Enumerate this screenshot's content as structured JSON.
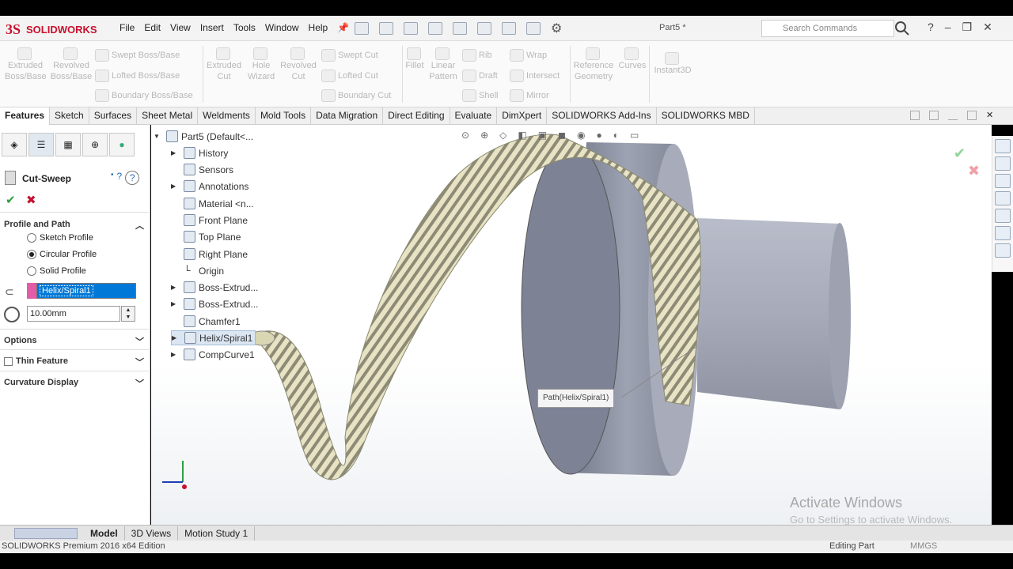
{
  "app": {
    "logo_text": "SOLIDWORKS",
    "doc_title": "Part5 *"
  },
  "menu": [
    "File",
    "Edit",
    "View",
    "Insert",
    "Tools",
    "Window",
    "Help"
  ],
  "search": {
    "placeholder": "Search Commands"
  },
  "ribbon": {
    "extruded_boss": "Extruded Boss/Base",
    "revolved_boss": "Revolved Boss/Base",
    "swept_boss": "Swept Boss/Base",
    "lofted_boss": "Lofted Boss/Base",
    "boundary_boss": "Boundary Boss/Base",
    "extruded_cut": "Extruded Cut",
    "hole_wizard": "Hole Wizard",
    "revolved_cut": "Revolved Cut",
    "swept_cut": "Swept Cut",
    "lofted_cut": "Lofted Cut",
    "boundary_cut": "Boundary Cut",
    "fillet": "Fillet",
    "linear_pattern": "Linear Pattern",
    "rib": "Rib",
    "draft": "Draft",
    "shell": "Shell",
    "wrap": "Wrap",
    "intersect": "Intersect",
    "mirror": "Mirror",
    "reference_geometry": "Reference Geometry",
    "curves": "Curves",
    "instant3d": "Instant3D"
  },
  "tabs": [
    "Features",
    "Sketch",
    "Surfaces",
    "Sheet Metal",
    "Weldments",
    "Mold Tools",
    "Data Migration",
    "Direct Editing",
    "Evaluate",
    "DimXpert",
    "SOLIDWORKS Add-Ins",
    "SOLIDWORKS MBD"
  ],
  "property_manager": {
    "title": "Cut-Sweep",
    "ok": "✔",
    "cancel": "✖",
    "help": "?",
    "section_profile_path": "Profile and Path",
    "sketch_profile": "Sketch Profile",
    "circular_profile": "Circular Profile",
    "solid_profile": "Solid Profile",
    "path_value": "Helix/Spiral1",
    "diameter_value": "10.00mm",
    "options": "Options",
    "thin_feature": "Thin Feature",
    "curvature_display": "Curvature Display"
  },
  "tree": {
    "root": "Part5  (Default<...",
    "items": [
      "History",
      "Sensors",
      "Annotations",
      "Material <n...",
      "Front Plane",
      "Top Plane",
      "Right Plane",
      "Origin",
      "Boss-Extrud...",
      "Boss-Extrud...",
      "Chamfer1",
      "Helix/Spiral1",
      "CompCurve1"
    ]
  },
  "callout": "Path(Helix/Spiral1)",
  "watermark": {
    "line1": "Activate Windows",
    "line2": "Go to Settings to activate Windows."
  },
  "bottom_tabs": [
    "Model",
    "3D Views",
    "Motion Study 1"
  ],
  "status": {
    "left": "SOLIDWORKS Premium 2016 x64 Edition",
    "mode": "Editing Part",
    "units": "MMGS"
  },
  "colors": {
    "accent": "#0078d7",
    "logo": "#c8102e",
    "path_color": "#e35ca7"
  }
}
